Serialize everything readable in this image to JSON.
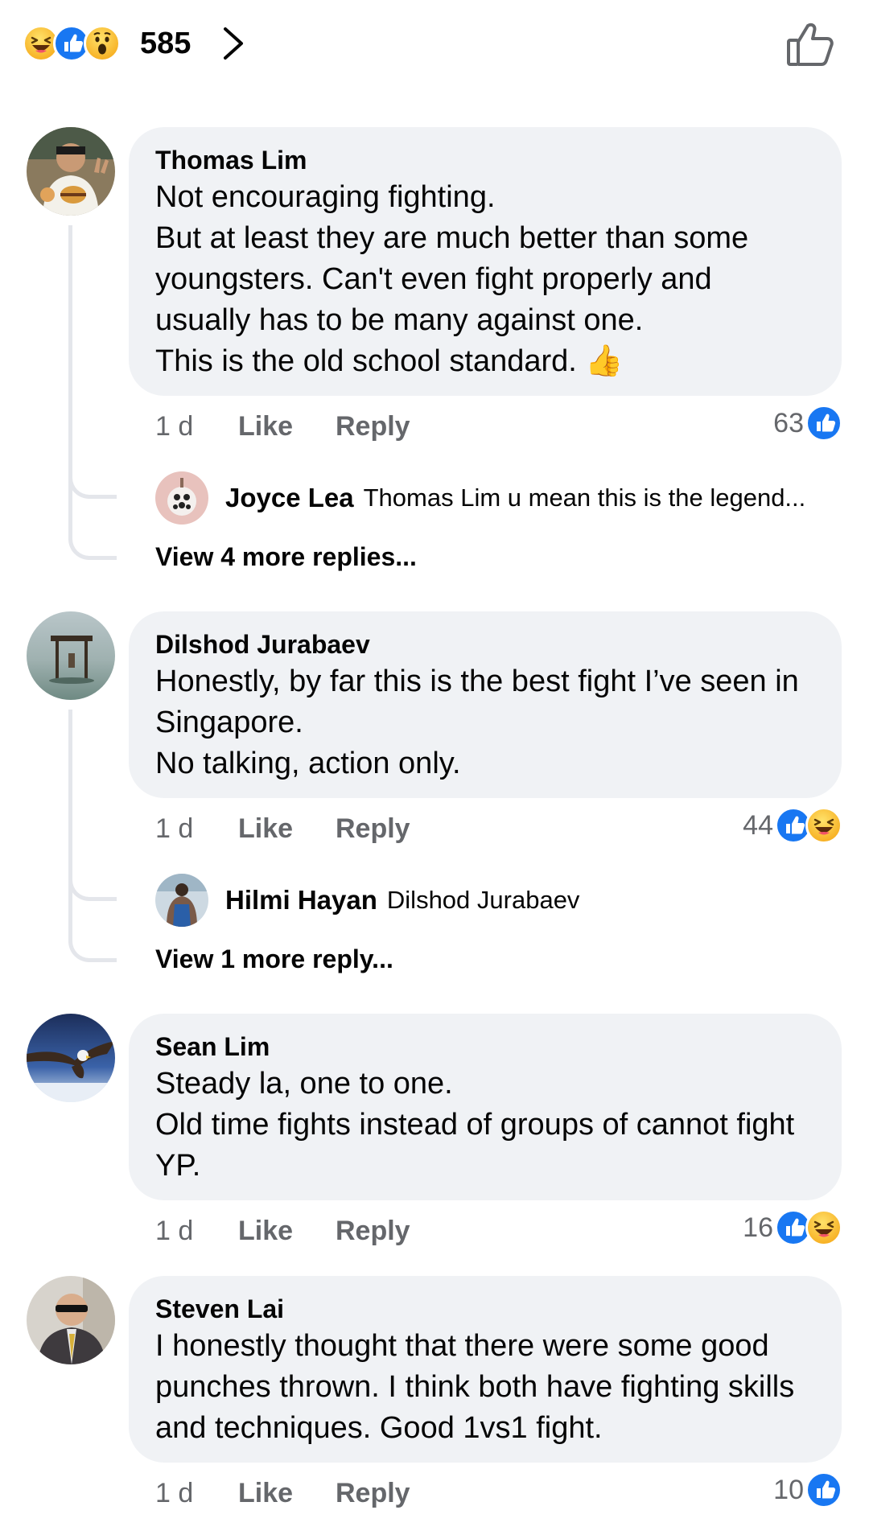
{
  "top_bar": {
    "reaction_icons": [
      "haha-icon",
      "like-icon",
      "wow-icon"
    ],
    "reaction_count": "585",
    "chevron_icon": "chevron-right-icon",
    "like_button_icon": "thumbs-up-outline-icon"
  },
  "colors": {
    "like_blue": "#1877f2",
    "bubble_bg": "#f0f2f5",
    "meta_gray": "#65676b",
    "thread_line": "#e4e6eb"
  },
  "comments": [
    {
      "author": "Thomas Lim",
      "text": "Not encouraging fighting.\nBut at least they are much better than some youngsters. Can't even fight properly and usually has to be many against one.\nThis is the old school standard. 👍",
      "time": "1 d",
      "like_label": "Like",
      "reply_label": "Reply",
      "reaction_count": "63",
      "reactions": [
        "like-icon"
      ],
      "reply_preview": {
        "author": "Joyce Lea",
        "text": "Thomas Lim u mean this is the legend..."
      },
      "more_replies": "View 4 more replies..."
    },
    {
      "author": "Dilshod Jurabaev",
      "text": "Honestly, by far this is the best fight I’ve seen in Singapore.\nNo talking, action only.",
      "time": "1 d",
      "like_label": "Like",
      "reply_label": "Reply",
      "reaction_count": "44",
      "reactions": [
        "like-icon",
        "haha-icon"
      ],
      "reply_preview": {
        "author": "Hilmi Hayan",
        "text": "Dilshod Jurabaev"
      },
      "more_replies": "View 1 more reply..."
    },
    {
      "author": "Sean Lim",
      "text": "Steady la, one to one.\nOld time fights instead of groups of  cannot fight YP.",
      "time": "1 d",
      "like_label": "Like",
      "reply_label": "Reply",
      "reaction_count": "16",
      "reactions": [
        "like-icon",
        "haha-icon"
      ]
    },
    {
      "author": "Steven Lai",
      "text": "I honestly thought that there were some good punches thrown. I think both have fighting skills and techniques. Good 1vs1 fight.",
      "time": "1 d",
      "like_label": "Like",
      "reply_label": "Reply",
      "reaction_count": "10",
      "reactions": [
        "like-icon"
      ]
    }
  ]
}
